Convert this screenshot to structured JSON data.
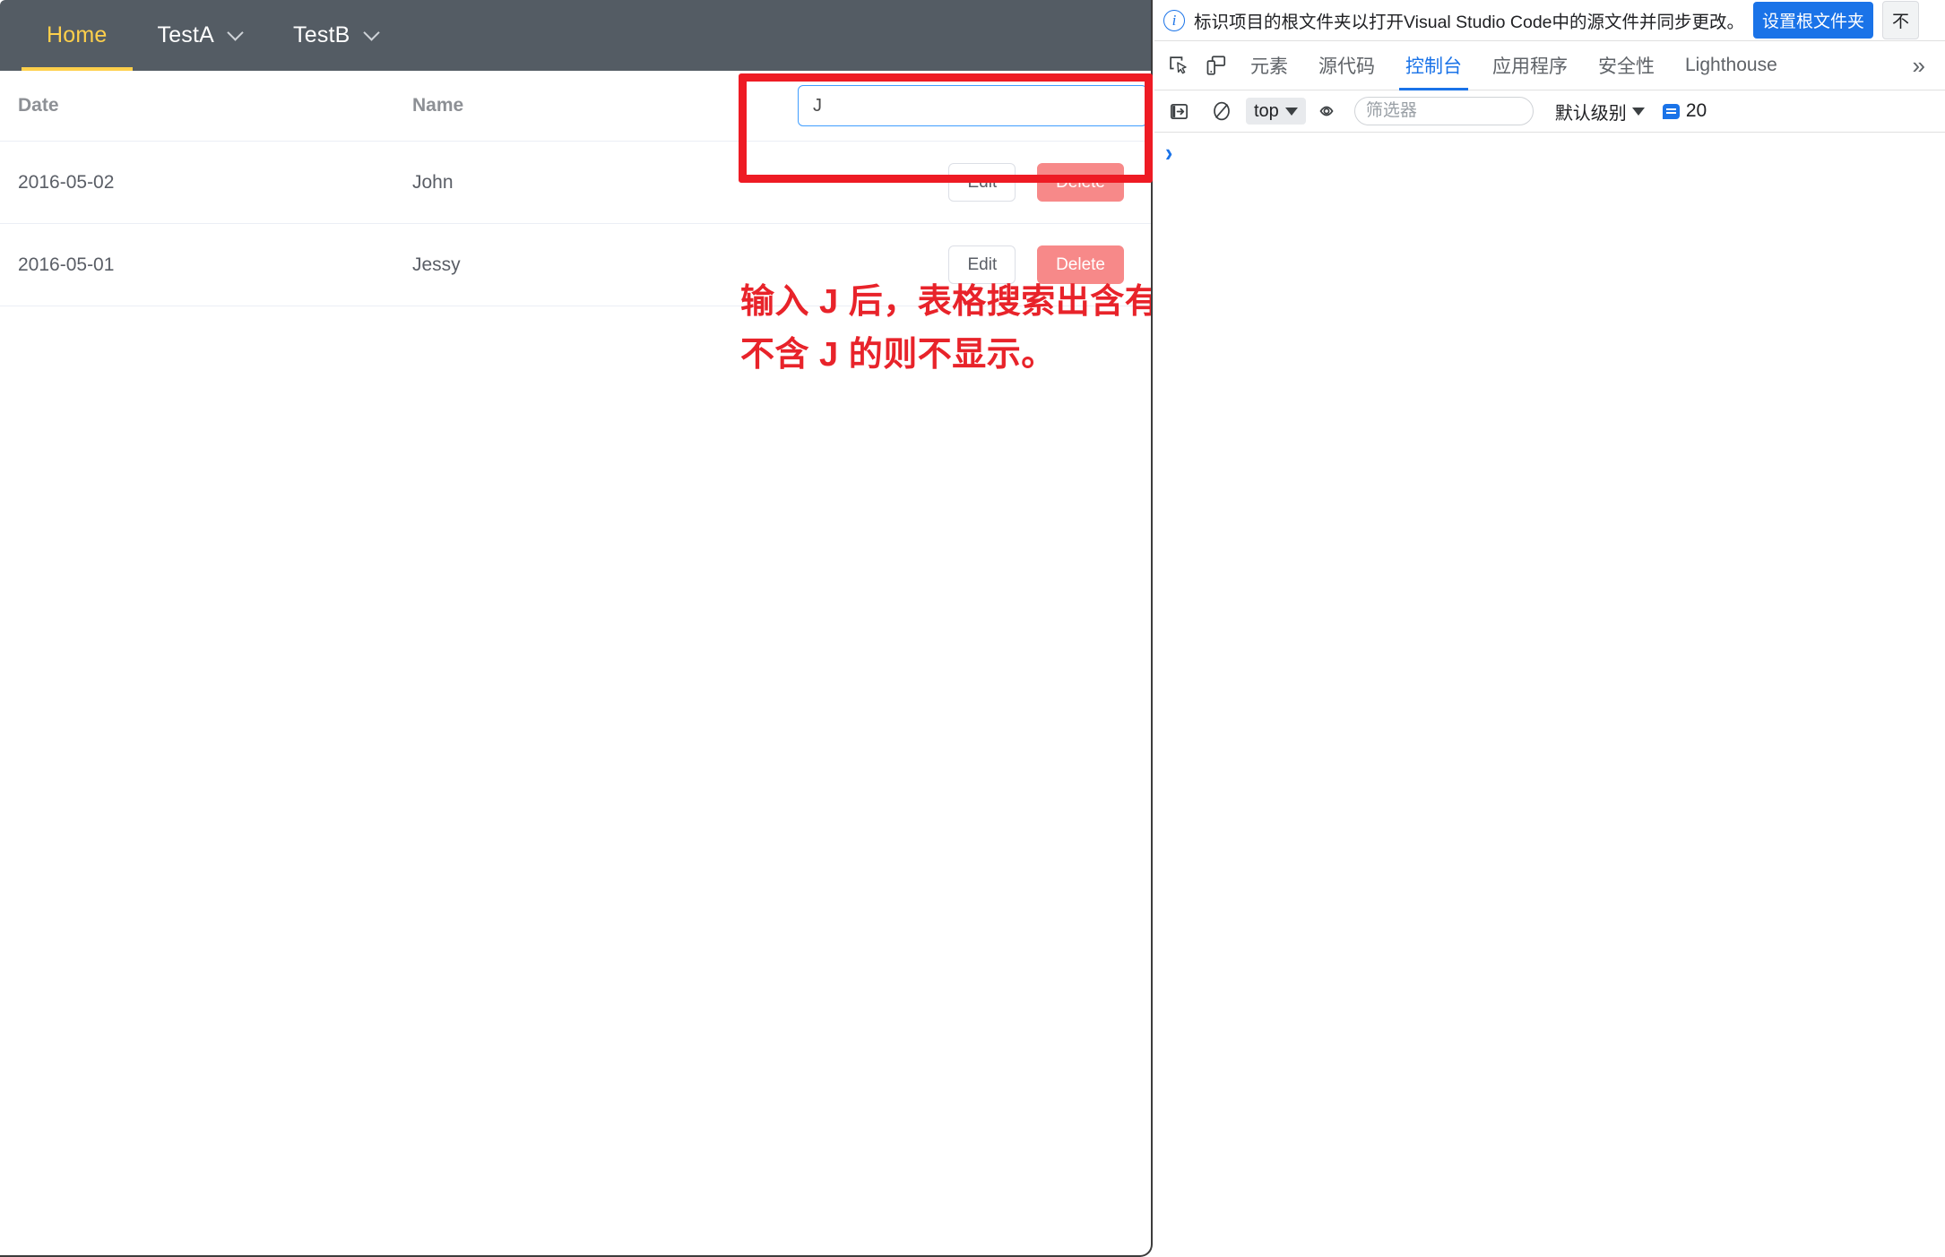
{
  "page": {
    "navbar": {
      "items": [
        {
          "label": "Home",
          "active": true,
          "has_caret": false,
          "icon": ""
        },
        {
          "label": "TestA",
          "active": false,
          "has_caret": true,
          "icon": "chevron-down-icon"
        },
        {
          "label": "TestB",
          "active": false,
          "has_caret": true,
          "icon": "chevron-down-icon"
        }
      ]
    },
    "table": {
      "columns": [
        "Date",
        "Name",
        ""
      ],
      "search": {
        "value": "J",
        "placeholder": ""
      },
      "rows": [
        {
          "date": "2016-05-02",
          "name": "John",
          "edit_label": "Edit",
          "delete_label": "Delete"
        },
        {
          "date": "2016-05-01",
          "name": "Jessy",
          "edit_label": "Edit",
          "delete_label": "Delete"
        }
      ]
    },
    "annotation": {
      "text": "输入 J 后，表格搜索出含有 J 的 name，\n不含 J 的则不显示。",
      "color": "#e8232a",
      "highlight_color": "#ee1b24"
    }
  },
  "devtools": {
    "infobar": {
      "icon": "info-icon",
      "message": "标识项目的根文件夹以打开Visual Studio Code中的源文件并同步更改。",
      "primary_button": "设置根文件夹",
      "secondary_button": "不"
    },
    "tabbar": {
      "inspect_icon": "inspect-element-icon",
      "device_icon": "device-toolbar-icon",
      "more_icon": "chevrons-right-icon",
      "tabs": [
        {
          "label": "元素",
          "active": false
        },
        {
          "label": "源代码",
          "active": false
        },
        {
          "label": "控制台",
          "active": true
        },
        {
          "label": "应用程序",
          "active": false
        },
        {
          "label": "安全性",
          "active": false
        },
        {
          "label": "Lighthouse",
          "active": false
        }
      ]
    },
    "console_toolbar": {
      "sidebar_icon": "console-sidebar-icon",
      "clear_icon": "clear-console-icon",
      "context": "top",
      "eye_icon": "live-expression-icon",
      "filter_placeholder": "筛选器",
      "filter_value": "",
      "level": "默认级别",
      "message_count": "20",
      "badge_color": "#1a73e8"
    },
    "console": {
      "prompt": "❯"
    }
  }
}
